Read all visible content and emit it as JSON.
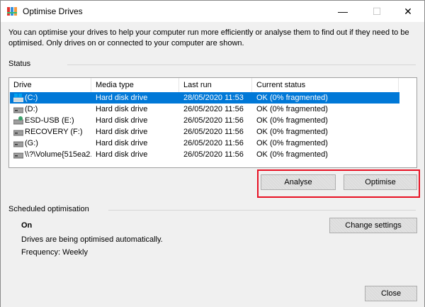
{
  "window": {
    "title": "Optimise Drives",
    "controls": {
      "minimize_glyph": "—",
      "maximize_glyph": "☐",
      "close_glyph": "✕"
    }
  },
  "intro_text": "You can optimise your drives to help your computer run more efficiently or analyse them to find out if they need to be optimised. Only drives on or connected to your computer are shown.",
  "status": {
    "label": "Status",
    "columns": [
      "Drive",
      "Media type",
      "Last run",
      "Current status"
    ],
    "rows": [
      {
        "drive": "(C:)",
        "media": "Hard disk drive",
        "last_run": "28/05/2020 11:53",
        "status": "OK (0% fragmented)",
        "icon": "windows-drive-icon",
        "selected": true
      },
      {
        "drive": "(D:)",
        "media": "Hard disk drive",
        "last_run": "26/05/2020 11:56",
        "status": "OK (0% fragmented)",
        "icon": "hard-drive-icon",
        "selected": false
      },
      {
        "drive": "ESD-USB (E:)",
        "media": "Hard disk drive",
        "last_run": "26/05/2020 11:56",
        "status": "OK (0% fragmented)",
        "icon": "usb-drive-icon",
        "selected": false
      },
      {
        "drive": "RECOVERY (F:)",
        "media": "Hard disk drive",
        "last_run": "26/05/2020 11:56",
        "status": "OK (0% fragmented)",
        "icon": "hard-drive-icon",
        "selected": false
      },
      {
        "drive": "(G:)",
        "media": "Hard disk drive",
        "last_run": "26/05/2020 11:56",
        "status": "OK (0% fragmented)",
        "icon": "hard-drive-icon",
        "selected": false
      },
      {
        "drive": "\\\\?\\Volume{515ea2...",
        "media": "Hard disk drive",
        "last_run": "26/05/2020 11:56",
        "status": "OK (0% fragmented)",
        "icon": "hard-drive-icon",
        "selected": false
      }
    ]
  },
  "actions": {
    "analyse_label": "Analyse",
    "optimise_label": "Optimise"
  },
  "scheduled": {
    "label": "Scheduled optimisation",
    "state": "On",
    "description": "Drives are being optimised automatically.",
    "frequency": "Frequency: Weekly",
    "change_label": "Change settings"
  },
  "footer": {
    "close_label": "Close"
  },
  "colors": {
    "selection": "#0078d7",
    "highlight_box": "#e81123",
    "button_face": "#e1e1e1"
  }
}
